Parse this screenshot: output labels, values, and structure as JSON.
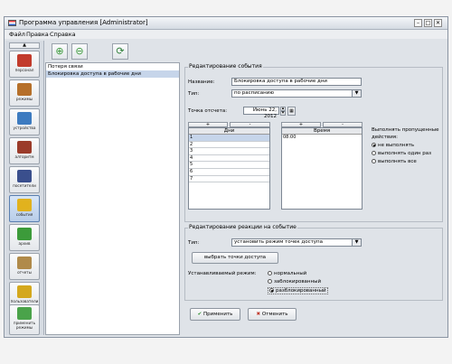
{
  "window": {
    "title": "Программа управления [Administrator]"
  },
  "menu": [
    "Файл",
    "Правка",
    "Справка"
  ],
  "sidebar": {
    "items": [
      {
        "label": "персонал",
        "color": "#c23b2c"
      },
      {
        "label": "режимы",
        "color": "#b6702a"
      },
      {
        "label": "устройства",
        "color": "#3d7bc0"
      },
      {
        "label": "алгоритм",
        "color": "#9b3b2a"
      },
      {
        "label": "посетители",
        "color": "#3a4f8d"
      },
      {
        "label": "события",
        "color": "#e1b21e"
      },
      {
        "label": "архив",
        "color": "#3c9b3a"
      },
      {
        "label": "отчеты",
        "color": "#b08a4a"
      },
      {
        "label": "пользователи",
        "color": "#d4a81d"
      }
    ],
    "apply": {
      "label": "применить режимы",
      "color": "#4aa34a"
    }
  },
  "events": [
    "Потеря связи",
    "Блокировка доступа в рабочие дни"
  ],
  "edit_event": {
    "title": "Редактирование события",
    "name_label": "Название:",
    "name_value": "Блокировка доступа в рабочие дни",
    "type_label": "Тип:",
    "type_value": "по расписанию",
    "start_label": "Точка отсчета:",
    "start_value": "Июнь 22, 2012",
    "plus": "+",
    "minus": "-",
    "days_header": "Дни",
    "days": [
      "1",
      "2",
      "3",
      "4",
      "5",
      "6",
      "7"
    ],
    "time_header": "Время",
    "times": [
      "08:00"
    ],
    "missed_title_1": "Выполнять пропущенные",
    "missed_title_2": "действия:",
    "missed_options": [
      "не выполнять",
      "выполнять один раз",
      "выполнять все"
    ]
  },
  "edit_reaction": {
    "title": "Редактирование реакции на событие",
    "type_label": "Тип:",
    "type_value": "установить режим точек доступа",
    "choose_button": "выбрать точки доступа",
    "mode_label": "Устанавливаемый режим:",
    "mode_options": [
      "нормальный",
      "заблокированный",
      "разблокированный"
    ]
  },
  "buttons": {
    "apply": "Применить",
    "cancel": "Отменить"
  }
}
